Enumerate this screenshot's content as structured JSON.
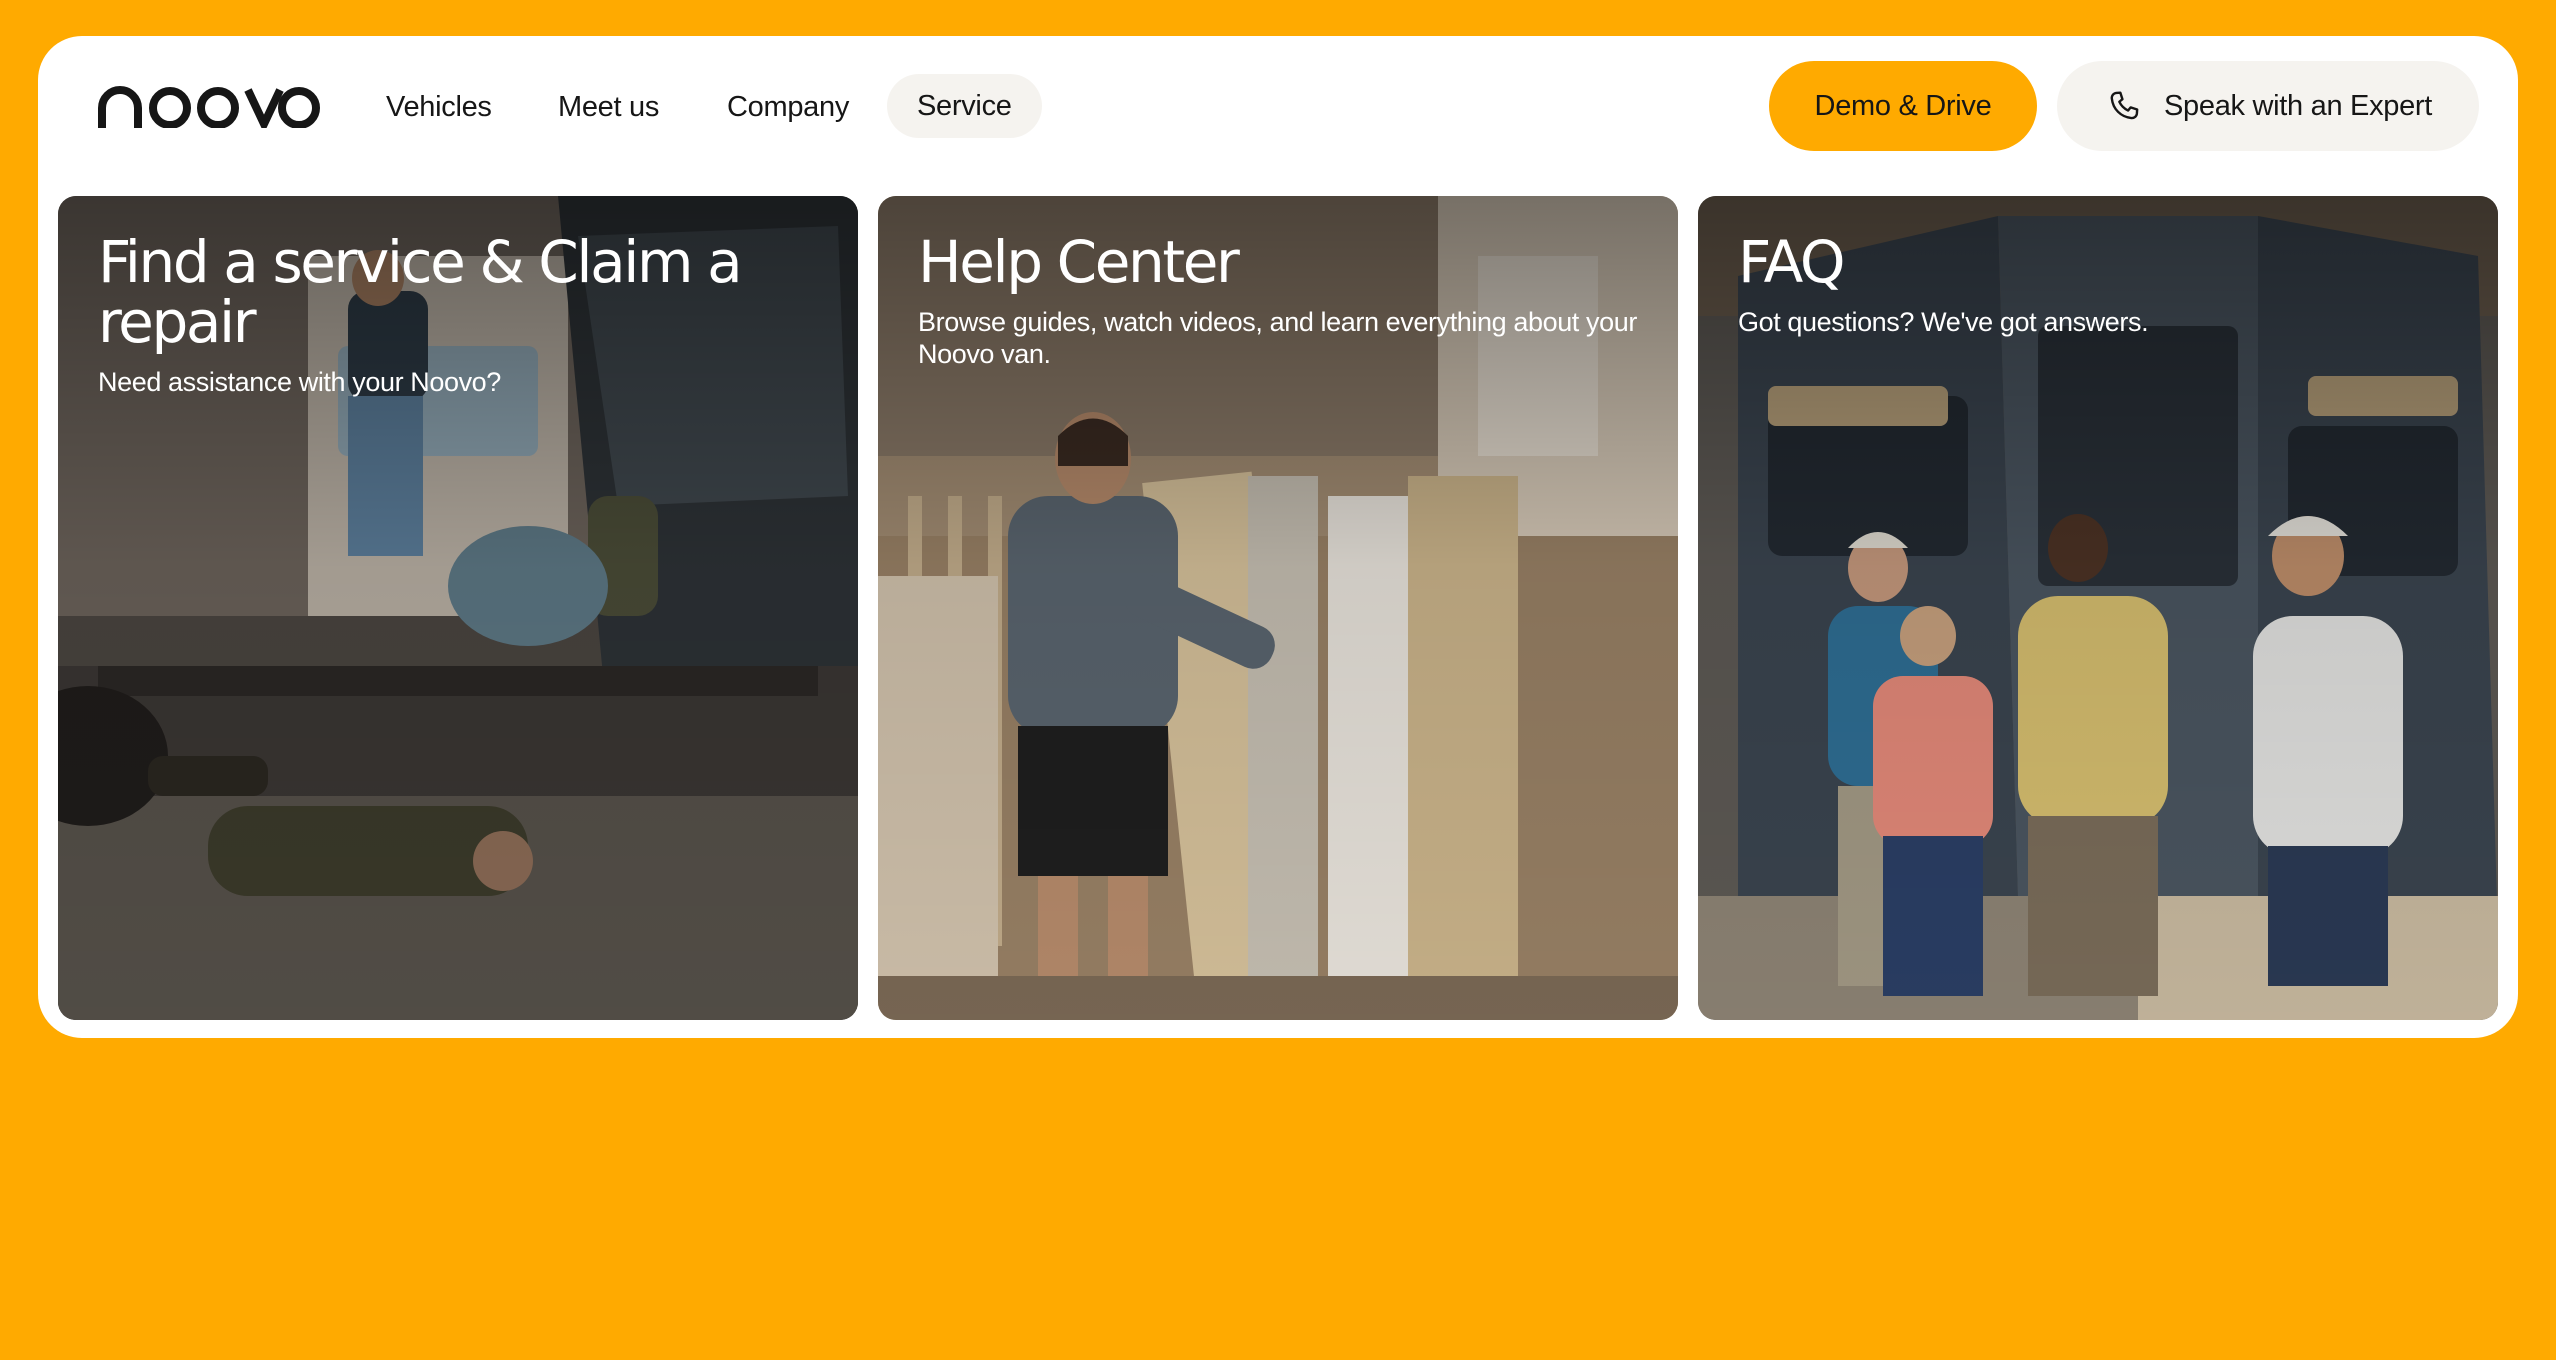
{
  "brand": {
    "logo_text": "noovo",
    "accent_color": "#FFAA00",
    "surface_color": "#F5F3EF"
  },
  "nav": {
    "items": [
      {
        "label": "Vehicles",
        "active": false
      },
      {
        "label": "Meet us",
        "active": false
      },
      {
        "label": "Company",
        "active": false
      },
      {
        "label": "Service",
        "active": true
      }
    ]
  },
  "header_actions": {
    "demo_label": "Demo & Drive",
    "expert_label": "Speak with an Expert",
    "expert_icon": "phone-icon"
  },
  "cards": [
    {
      "title": "Find a service & Claim a repair",
      "subtitle": "Need assistance with your Noovo?"
    },
    {
      "title": "Help Center",
      "subtitle": "Browse guides, watch videos, and learn everything about your Noovo van."
    },
    {
      "title": "FAQ",
      "subtitle": "Got questions? We've got answers."
    }
  ]
}
